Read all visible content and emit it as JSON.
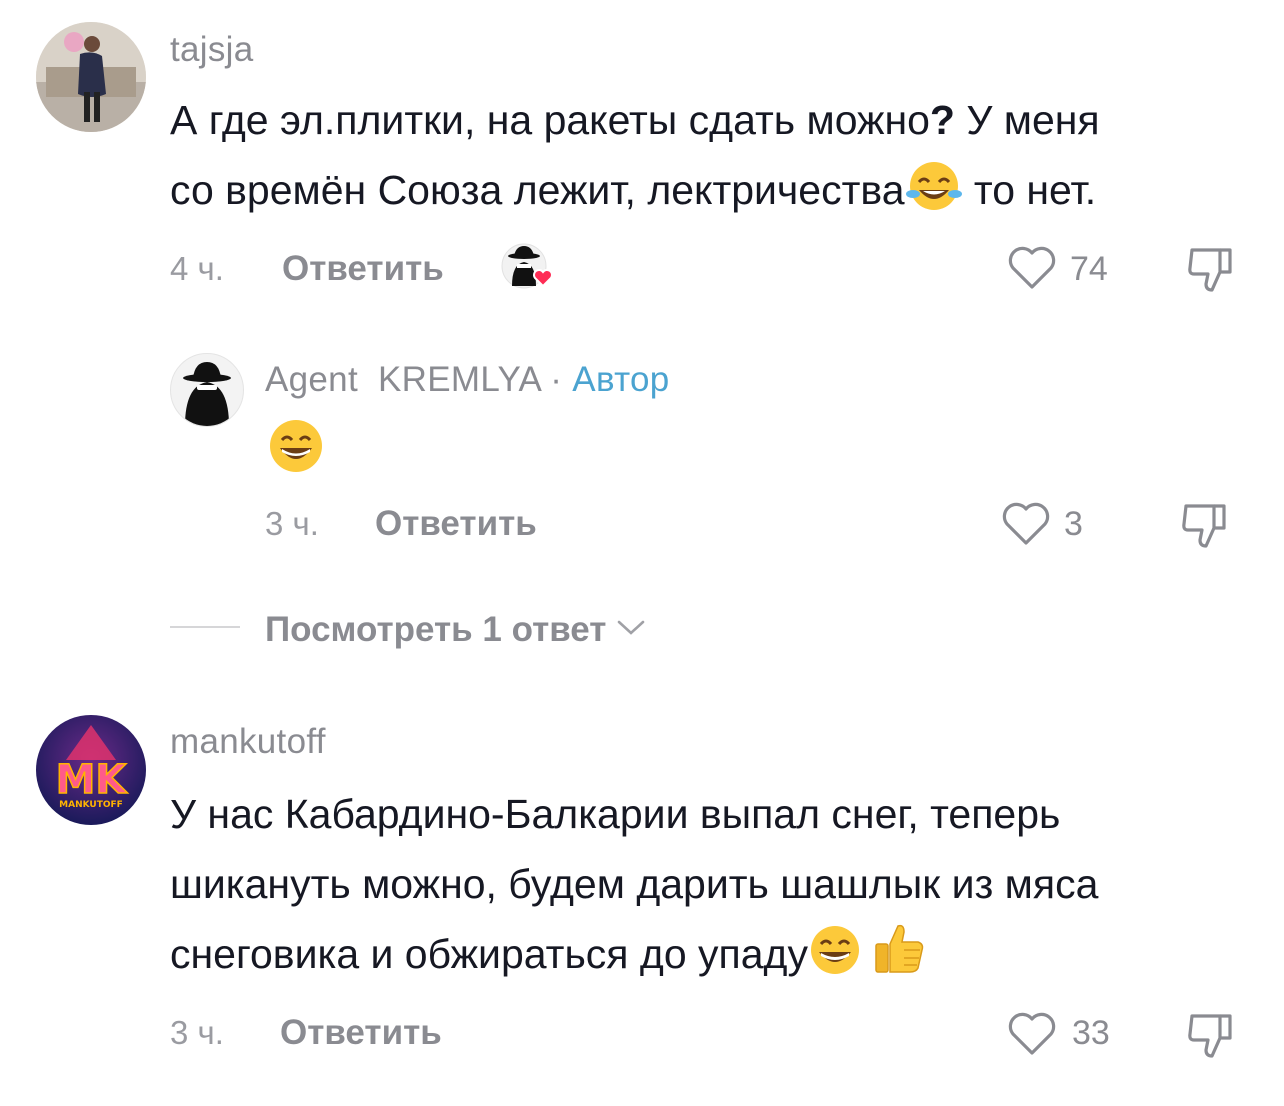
{
  "comments": [
    {
      "username": "tajsja",
      "text_line1": "А где эл.плитки, на ракеты сдать можно",
      "text_line1_q": "?",
      "text_line1_end": " У меня",
      "text_line2": "со времён Союза лежит, лектричества",
      "text_line2_end": " то нет.",
      "time": "4 ч.",
      "reply_label": "Ответить",
      "likes": "74"
    },
    {
      "username": "Agent  KREMLYA",
      "separator": "·",
      "author_badge": "Автор",
      "time": "3 ч.",
      "reply_label": "Ответить",
      "likes": "3"
    },
    {
      "username": "mankutoff",
      "avatar_text": "MK",
      "avatar_subtext": "MANKUTOFF",
      "text_line1": "У нас Кабардино-Балкарии выпал снег, теперь",
      "text_line2": "шикануть можно, будем дарить шашлык из мяса",
      "text_line3": "снеговика и обжираться до упаду",
      "time": "3 ч.",
      "reply_label": "Ответить",
      "likes": "33"
    }
  ],
  "view_replies": "Посмотреть 1 ответ",
  "icons": [
    "heart-icon",
    "dislike-icon",
    "chevron-down-icon",
    "laughing-emoji",
    "grin-emoji",
    "thumbs-up-emoji",
    "creator-liked-badge"
  ],
  "colors": {
    "text": "#161823",
    "muted": "#8a8b91",
    "author": "#4ba3d0",
    "heart_badge": "#fe2c55"
  }
}
